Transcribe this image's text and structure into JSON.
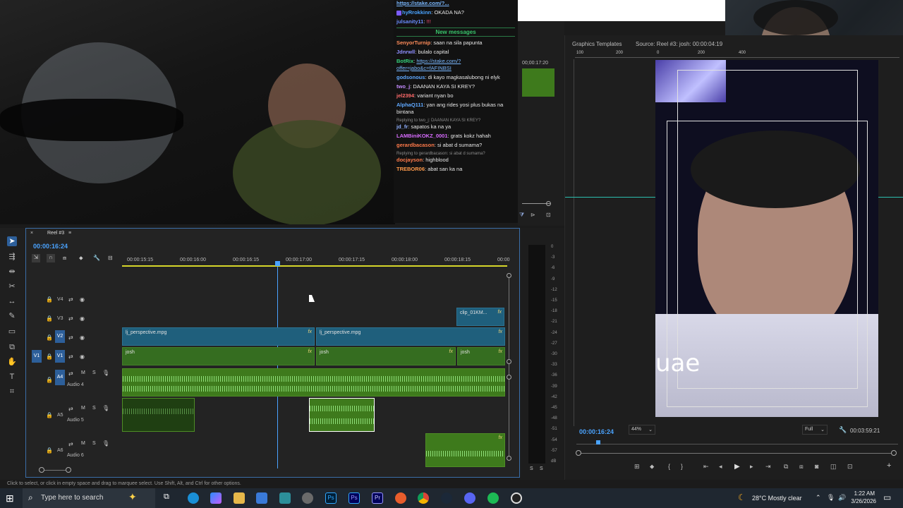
{
  "chat": {
    "top_link": "https://stake.com/?...",
    "messages_before": [
      {
        "user": "hyRrokkinn",
        "text": "OKADA NA?",
        "color": "#4aa3ff"
      },
      {
        "user": "julsanity11",
        "text": "!!!",
        "color": "#6a8cff"
      }
    ],
    "new_messages_label": "New messages",
    "messages": [
      {
        "user": "SenyorTurnip",
        "text": "saan na sila papunta",
        "color": "#ff8c5a",
        "reply": ""
      },
      {
        "user": "Jdnrwll",
        "text": "bulalo capital",
        "color": "#8f8fff",
        "reply": ""
      },
      {
        "user": "BotRix",
        "text": "https://stake.com/?offer=jabo&c=fAFINBSI",
        "color": "#35d07a",
        "reply": ""
      },
      {
        "user": "godsonous",
        "text": "di kayo magkasalubong ni elyk",
        "color": "#5fa8ff",
        "reply": ""
      },
      {
        "user": "two_j",
        "text": "DAANAN KAYA SI KREY?",
        "color": "#c58bff",
        "reply": ""
      },
      {
        "user": "jel2394",
        "text": "variant nyan bo",
        "color": "#ff6a6a",
        "reply": ""
      },
      {
        "user": "AlphaQ111",
        "text": "yan ang rides yosi plus bukas na bintana",
        "color": "#5fa8ff",
        "reply": ""
      },
      {
        "user": "jd_fr",
        "text": "sapatos ka na ya",
        "color": "#8fb0ff",
        "reply": "Replying to two_j: DAANAN KAYA SI KREY?"
      },
      {
        "user": "LAMBiniKOKZ_0001",
        "text": "grats kokz hahah",
        "color": "#d86cff",
        "reply": ""
      },
      {
        "user": "gerardbacason",
        "text": "si abat d sumama?",
        "color": "#ff7a4a",
        "reply": ""
      },
      {
        "user": "docjayson",
        "text": "highblood",
        "color": "#ff7a4a",
        "reply": "Replying to gerardbacason: si abat d sumama?"
      },
      {
        "user": "TREBOR06",
        "text": "abat san ka na",
        "color": "#ff9a4a",
        "reply": ""
      }
    ]
  },
  "mini_timecode": "00;00:17:20",
  "source_panel": {
    "tab_graphics": "Graphics Templates",
    "tab_source": "Source: Reel #3: josh: 00:00:04:19",
    "ruler": [
      "100",
      "200",
      "0",
      "200",
      "400"
    ],
    "overlay_text": "uae",
    "current_time": "00:00:16:24",
    "zoom": "44%",
    "resolution": "Full",
    "duration": "00:03:59:21"
  },
  "timeline": {
    "tab_label": "Reel #3",
    "timecode": "00:00:16:24",
    "ruler": [
      "00:00:15:15",
      "00:00:16:00",
      "00:00:16:15",
      "00:00:17:00",
      "00:00:17:15",
      "00:00:18:00",
      "00:00:18:15",
      "00:00"
    ],
    "tracks": {
      "v4": "V4",
      "v3": "V3",
      "v2": "V2",
      "v1": "V1",
      "a4": "A4",
      "a4_name": "Audio 4",
      "a5": "A5",
      "a5_name": "Audio 5",
      "a6": "A6",
      "a6_name": "Audio 6"
    },
    "source_patch_v1": "V1",
    "clips": {
      "v3_clip": "clip_01KM...",
      "v2_clip1": "lj_perspective.mpg",
      "v2_clip2": "lj_perspective.mpg",
      "v1_clip1": "josh",
      "v1_clip2": "josh",
      "v1_clip3": "josh"
    },
    "db_scale": [
      "0",
      "-3",
      "-6",
      "-9",
      "-12",
      "-15",
      "-18",
      "-21",
      "-24",
      "-27",
      "-30",
      "-33",
      "-36",
      "-39",
      "-42",
      "-45",
      "-48",
      "-51",
      "-54",
      "-57",
      "dB"
    ],
    "meter_solo": "S"
  },
  "status_bar": "Click to select, or click in empty space and drag to marquee select. Use Shift, Alt, and Ctrl for other options.",
  "taskbar": {
    "search_placeholder": "Type here to search",
    "weather": "28°C  Mostly clear",
    "time": "1:22 AM",
    "date": "3/26/2026"
  }
}
